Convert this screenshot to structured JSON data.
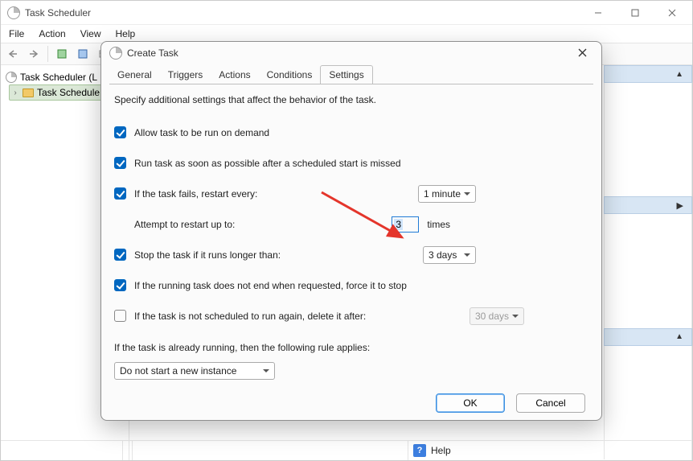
{
  "window": {
    "title": "Task Scheduler"
  },
  "menu": {
    "file": "File",
    "action": "Action",
    "view": "View",
    "help": "Help"
  },
  "tree": {
    "root": "Task Scheduler (L",
    "child": "Task Schedule"
  },
  "modal": {
    "title": "Create Task",
    "tabs": {
      "general": "General",
      "triggers": "Triggers",
      "actions": "Actions",
      "conditions": "Conditions",
      "settings": "Settings"
    },
    "desc": "Specify additional settings that affect the behavior of the task.",
    "allow_demand": "Allow task to be run on demand",
    "run_asap": "Run task as soon as possible after a scheduled start is missed",
    "restart_every": "If the task fails, restart every:",
    "restart_every_val": "1 minute",
    "attempt_label": "Attempt to restart up to:",
    "attempt_value": "3",
    "times": "times",
    "stop_longer": "Stop the task if it runs longer than:",
    "stop_longer_val": "3 days",
    "force_stop": "If the running task does not end when requested, force it to stop",
    "delete_after": "If the task is not scheduled to run again, delete it after:",
    "delete_after_val": "30 days",
    "rule_text": "If the task is already running, then the following rule applies:",
    "rule_val": "Do not start a new instance",
    "ok": "OK",
    "cancel": "Cancel"
  },
  "status": {
    "help": "Help"
  }
}
